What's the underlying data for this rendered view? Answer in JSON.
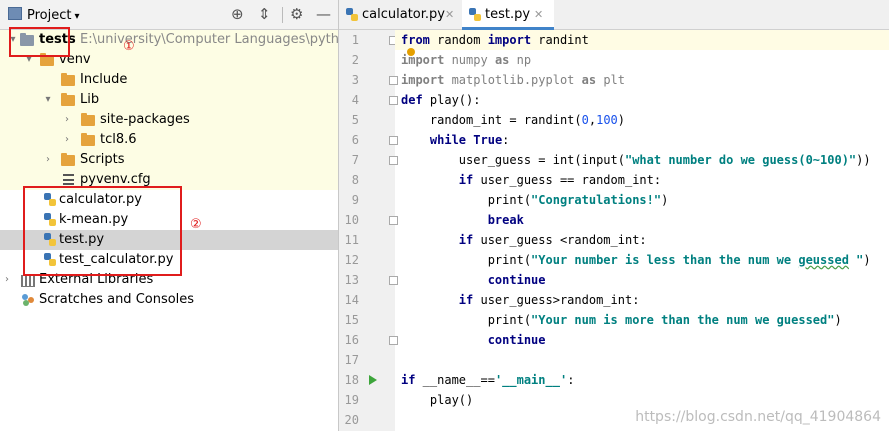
{
  "project_panel": {
    "title": "Project",
    "root": {
      "name": "tests",
      "path": "E:\\university\\Computer Languages\\python\\pro"
    },
    "tree": {
      "venv": "venv",
      "include": "Include",
      "lib": "Lib",
      "site_packages": "site-packages",
      "tcl": "tcl8.6",
      "scripts": "Scripts",
      "pyvenv": "pyvenv.cfg",
      "calculator": "calculator.py",
      "kmean": "k-mean.py",
      "test": "test.py",
      "test_calculator": "test_calculator.py",
      "external": "External Libraries",
      "scratches": "Scratches and Consoles"
    },
    "annotations": {
      "mark1": "①",
      "mark2": "②"
    }
  },
  "editor": {
    "tabs": [
      {
        "label": "calculator.py"
      },
      {
        "label": "test.py"
      }
    ],
    "active_tab": "test.py",
    "line_numbers": [
      "1",
      "2",
      "3",
      "4",
      "5",
      "6",
      "7",
      "8",
      "9",
      "10",
      "11",
      "12",
      "13",
      "14",
      "15",
      "16",
      "17",
      "18",
      "19",
      "20"
    ],
    "code": {
      "l1": [
        "from",
        " random ",
        "import",
        " randint"
      ],
      "l2": [
        "import",
        " numpy ",
        "as",
        " np"
      ],
      "l3": [
        "import",
        " matplotlib.pyplot ",
        "as",
        " plt"
      ],
      "l4": [
        "def",
        " play():"
      ],
      "l5": [
        "    random_int = randint(",
        "0",
        ",",
        "100",
        ")"
      ],
      "l6": [
        "    ",
        "while",
        " ",
        "True",
        ":"
      ],
      "l7": [
        "        user_guess = int(input(",
        "\"what number do we guess(0~100)\"",
        "))"
      ],
      "l8": [
        "        ",
        "if",
        " user_guess == random_int:"
      ],
      "l9": [
        "            print(",
        "\"Congratulations!\"",
        ")"
      ],
      "l10": [
        "            ",
        "break"
      ],
      "l11": [
        "        ",
        "if",
        " user_guess <random_int:"
      ],
      "l12": [
        "            print(",
        "\"Your number is less than the num we ",
        "geussed",
        " \"",
        ")"
      ],
      "l13": [
        "            ",
        "continue"
      ],
      "l14": [
        "        ",
        "if",
        " user_guess>random_int:"
      ],
      "l15": [
        "            print(",
        "\"Your num is more than the num we guessed\"",
        ")"
      ],
      "l16": [
        "            ",
        "continue"
      ],
      "l18": [
        "if",
        " __name__==",
        "'__main__'",
        ":"
      ],
      "l19": [
        "    play()"
      ]
    }
  },
  "watermark": "https://blog.csdn.net/qq_41904864",
  "colors": {
    "annotation_red": "#e01c1c",
    "tab_underline": "#4083c9",
    "keyword": "#000080",
    "string": "#067d17"
  }
}
